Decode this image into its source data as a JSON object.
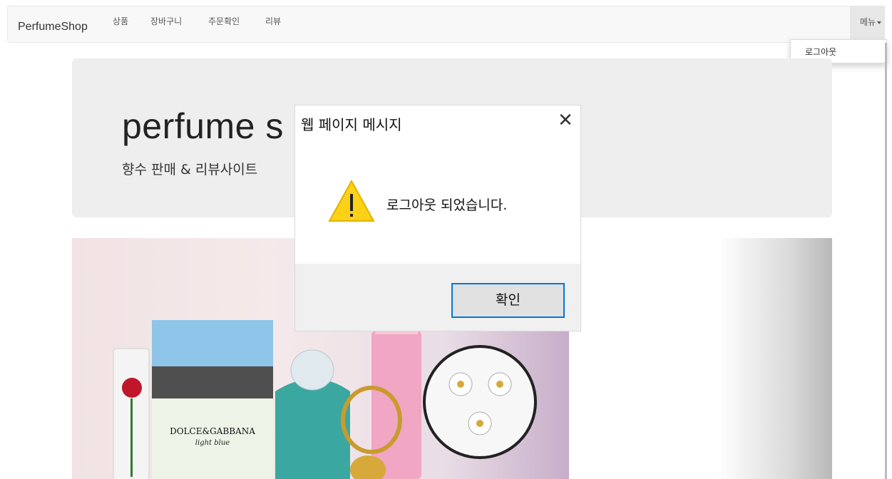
{
  "navbar": {
    "brand": "PerfumeShop",
    "items": [
      {
        "label": "상품"
      },
      {
        "label": "장바구니"
      },
      {
        "label": "주문확인"
      },
      {
        "label": "리뷰"
      }
    ],
    "menu_label": "메뉴"
  },
  "dropdown": {
    "logout_label": "로그아웃"
  },
  "jumbotron": {
    "title": "perfume s",
    "subtitle": "향수 판매 & 리뷰사이트"
  },
  "dialog": {
    "title": "웹 페이지 메시지",
    "message": "로그아웃 되었습니다.",
    "ok_label": "확인",
    "close_symbol": "✕",
    "icon": "warning-icon"
  },
  "colors": {
    "accent_border": "#0078d7",
    "warning_yellow": "#fcd116"
  }
}
